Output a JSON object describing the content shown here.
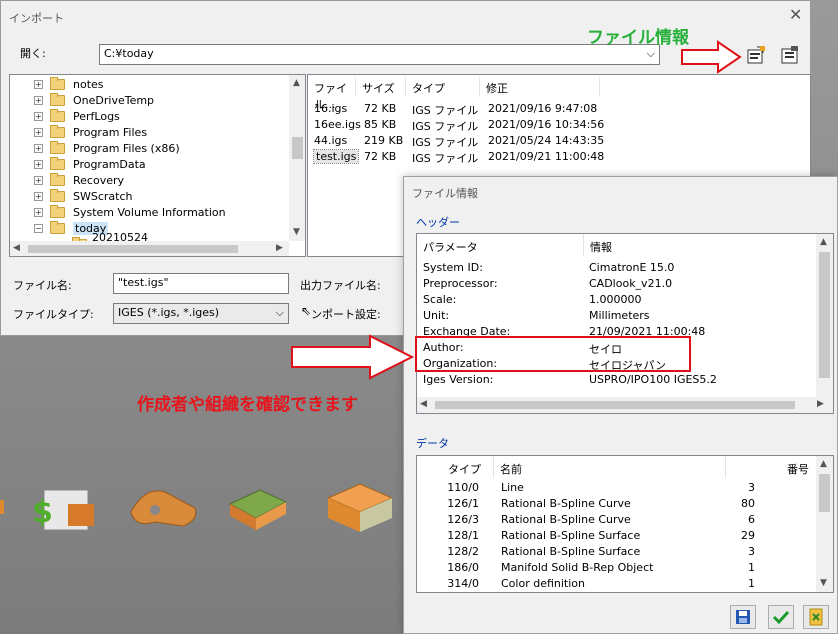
{
  "import_dialog": {
    "title": "インポート",
    "open_label": "開く:",
    "path": "C:¥today",
    "tree_items": [
      "notes",
      "OneDriveTemp",
      "PerfLogs",
      "Program Files",
      "Program Files (x86)",
      "ProgramData",
      "Recovery",
      "SWScratch",
      "System Volume Information",
      "today"
    ],
    "tree_partial": "20210524",
    "columns": [
      "ファイル...",
      "サイズ",
      "タイプ",
      "修正"
    ],
    "files": [
      {
        "name": "16.igs",
        "size": "72 KB",
        "type": "IGS ファイル",
        "date": "2021/09/16 9:47:08"
      },
      {
        "name": "16ee.igs",
        "size": "85 KB",
        "type": "IGS ファイル",
        "date": "2021/09/16 10:34:56"
      },
      {
        "name": "44.igs",
        "size": "219 KB",
        "type": "IGS ファイル",
        "date": "2021/05/24 14:43:35"
      },
      {
        "name": "test.igs",
        "size": "72 KB",
        "type": "IGS ファイル",
        "date": "2021/09/21 11:00:48"
      }
    ],
    "filename_label": "ファイル名:",
    "filename_value": "\"test.igs\"",
    "output_label": "出力ファイル名:",
    "filetype_label": "ファイルタイプ:",
    "filetype_value": "IGES (*.igs, *.iges)",
    "import_setting_label": "ンポート設定:"
  },
  "annotations": {
    "file_info": "ファイル情報",
    "author_note": "作成者や組織を確認できます"
  },
  "file_info_dialog": {
    "title": "ファイル情報",
    "header_group": "ヘッダー",
    "header_cols": [
      "パラメータ",
      "情報"
    ],
    "header_rows": [
      {
        "param": "System ID:",
        "value": "CimatronE 15.0"
      },
      {
        "param": "Preprocessor:",
        "value": "CADlook_v21.0"
      },
      {
        "param": "Scale:",
        "value": "1.000000"
      },
      {
        "param": "Unit:",
        "value": "Millimeters"
      },
      {
        "param": "Exchange Date:",
        "value": "21/09/2021 11:00:48"
      },
      {
        "param": "Author:",
        "value": "セイロ"
      },
      {
        "param": "Organization:",
        "value": "セイロジャパン"
      },
      {
        "param": "Iges Version:",
        "value": "USPRO/IPO100 IGES5.2"
      }
    ],
    "data_group": "データ",
    "data_cols": [
      "タイプ",
      "名前",
      "番号"
    ],
    "data_rows": [
      {
        "type": "110/0",
        "name": "Line",
        "num": "3"
      },
      {
        "type": "126/1",
        "name": "Rational B-Spline Curve",
        "num": "80"
      },
      {
        "type": "126/3",
        "name": "Rational B-Spline Curve",
        "num": "6"
      },
      {
        "type": "128/1",
        "name": "Rational B-Spline Surface",
        "num": "29"
      },
      {
        "type": "128/2",
        "name": "Rational B-Spline Surface",
        "num": "3"
      },
      {
        "type": "186/0",
        "name": "Manifold Solid B-Rep Object",
        "num": "1"
      },
      {
        "type": "314/0",
        "name": "Color definition",
        "num": "1"
      }
    ]
  }
}
